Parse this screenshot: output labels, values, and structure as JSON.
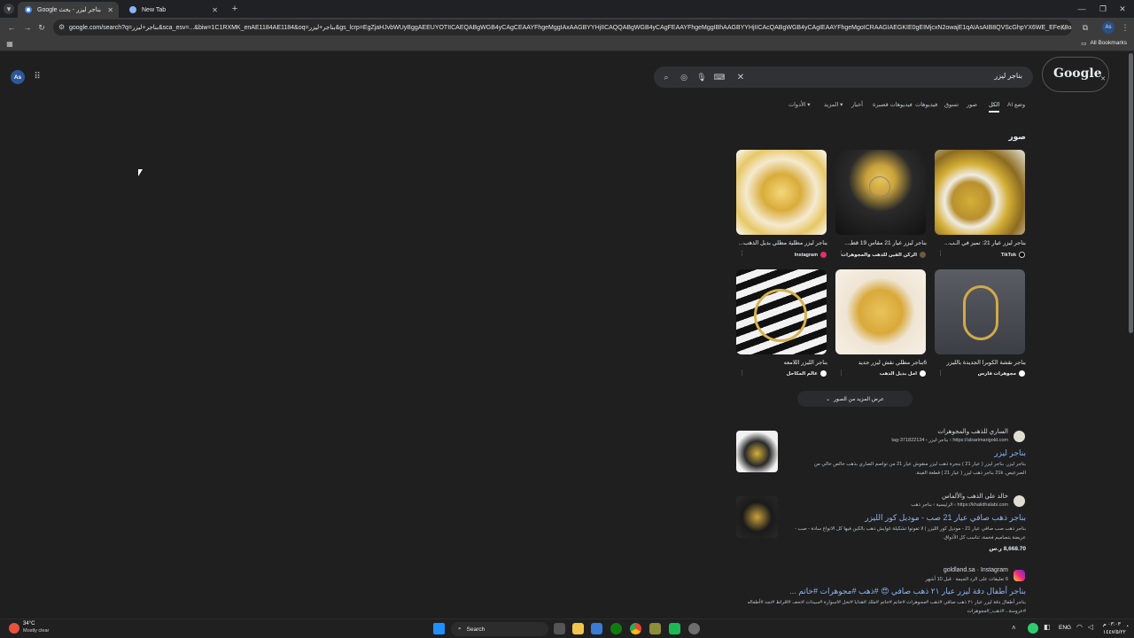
{
  "browser": {
    "tabs": [
      {
        "label": "بناجر ليزر - بحث Google",
        "active": true
      },
      {
        "label": "New Tab",
        "active": false
      }
    ],
    "new_tab_label": "+",
    "url": "google.com/search?q=بناجر+ليزر&sca_esv=...&biw=1C1RXMK_enAE1184AE1184&oq=بناجر+ليزر&gs_lcrp=EgZjaHJvbWUyBggAEEUYOTIICAEQABgWGB4yCAgCEAAYFhgeMggIAxAAGBYYHjIICAQQABgWGB4yCAgFEAAYFhgeMggIBhAAGBYYHjIICAcQABgWGB4yCAgIEAAYFhgeMgoICRAAGIAEGKIE0gEIMjcxN2owajE1qAIAsAIB8QVScGhpYX6WE_EFeX8oaWF-ihM&sourceid=chro...",
    "bookmarks_label": "All Bookmarks",
    "profile": "As"
  },
  "google": {
    "logo": "Google",
    "query": "بناجر ليزر",
    "profile": "As",
    "nav_tabs": [
      {
        "label": "وضع AI",
        "active": false
      },
      {
        "label": "الكل",
        "active": true
      },
      {
        "label": "صور",
        "active": false
      },
      {
        "label": "تسوق",
        "active": false
      },
      {
        "label": "فيديوهات",
        "active": false
      },
      {
        "label": "فيديوهات قصيرة",
        "active": false
      },
      {
        "label": "أخبار",
        "active": false
      },
      {
        "label": "المزيد",
        "active": false
      },
      {
        "label": "الأدوات",
        "active": false
      }
    ],
    "images_heading": "صور",
    "image_cards": [
      {
        "title": "بناجر ليزر عيار 21: تميز في الـب...",
        "source": "TikTok",
        "src_color": "#000000"
      },
      {
        "title": "بناجر ليزر عيار 21 مقاس 19 قطـ...",
        "source": "الركن الفين للذهب والمجوهرات",
        "src_color": "#6b5b3e"
      },
      {
        "title": "بناجر ليزر مطلية مطلي بديل الذهب...",
        "source": "Instagram",
        "src_color": "#e1306c"
      },
      {
        "title": "بناجر نقشة الكوبرا الجديدة بالليزر",
        "source": "مجوهرات فارس",
        "src_color": "#ffffff"
      },
      {
        "title": "6بناجر مطلي نقش ليزر جديد",
        "source": "امل بديل الذهب",
        "src_color": "#ffffff"
      },
      {
        "title": "بناجر الليزر اللامعه",
        "source": "عالم المكاحل",
        "src_color": "#ffffff"
      }
    ],
    "more_images": "عرض المزيد من الصور",
    "results": [
      {
        "site": "الساري للذهب والمجوهرات",
        "url": "https://alsarimarigold.com › بناجر-ليزر › tag-371822134",
        "title": "بناجر ليزر",
        "snippet_1": "بناجر ليزر. بناجر ليزر ( عيار 21 ) بنجرة ذهب ليزر منقوش عيار 21 من تواصم الصاري بذهب خالص خالي من",
        "snippet_2": "الصرعيص. 21k بناجر ذهب ليزر ( عيار 21 ) قطعة الفينة."
      },
      {
        "site": "خالد علي الذهب والألماس",
        "url": "https://khalidhalabi.com › الرئيسية › بناجر ذهب",
        "title": "بناجر ذهب صافي عيار 21 صب - موديل كور الليزر",
        "snippet_1": "بناجر ذهب صب صافي عيار 21 - موديل كور الليزر | لا تفوتوا تشكيلة غوايش ذهب بالكين فيها كل الانواع سادة - صب -",
        "snippet_2": "عريضة بتصاميم فخمة، تناسب كل الأذواق.",
        "price": "8,668.70 ر.س"
      },
      {
        "site": "goldland.sa · Instagram",
        "url": "6 تعليقات على الرد الجيمة · قبل 10 أشهر",
        "title": "بناجر أطفال دقة ليزر عيار ٢١ ذهب صافي 😍 #ذهب #مجوهرات #خاتم ...",
        "snippet_1": "بناجر أطفال دقة ليزر عيار ٢١ ذهب صافي #ذهب #مجوهرات #خاتم #خاتم #ملك #هدايا #تخل #اسوارة #سيدات #تحف #اقراط #تجد #أطفاله",
        "snippet_2": "#عروسة ، #ذهب_#مجوهرات"
      }
    ]
  },
  "taskbar": {
    "weather_temp": "34°C",
    "weather_desc": "Mostly clear",
    "search_label": "Search",
    "lang": "ENG",
    "time": "٠٣:٠٣ م",
    "date": "١٤٤٧/٥/٢٢"
  },
  "colors": {
    "accent_blue": "#8ab4f8",
    "page_bg": "#1f1f1f",
    "search_bg": "#303134"
  }
}
